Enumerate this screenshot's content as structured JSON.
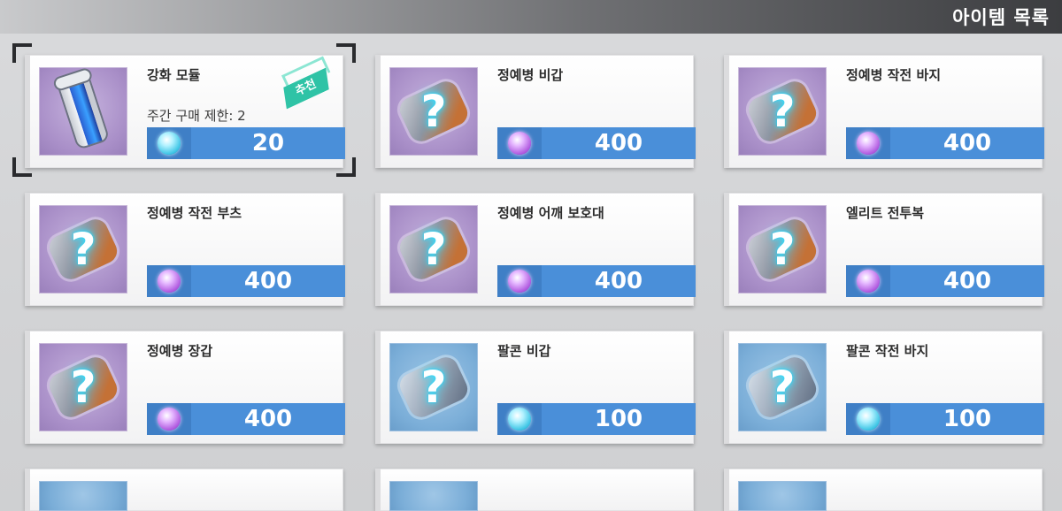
{
  "header": {
    "title": "아이템 목록"
  },
  "colors": {
    "price_bar": "#4a8fd9",
    "badge": "#2fc3a6",
    "selection": "#2a2b2e"
  },
  "items": [
    {
      "name": "강화 모듈",
      "limit": "주간 구매 제한: 2",
      "badge": "추천",
      "price": "20",
      "currency_icon": "cyan-gem-icon",
      "thumb_icon": "canister-icon",
      "bg": "purple",
      "selected": true
    },
    {
      "name": "정예병 비갑",
      "price": "400",
      "currency_icon": "purple-gem-icon",
      "thumb_icon": "unknown-gear-icon",
      "bg": "purple"
    },
    {
      "name": "정예병 작전 바지",
      "price": "400",
      "currency_icon": "purple-gem-icon",
      "thumb_icon": "unknown-gear-icon",
      "bg": "purple"
    },
    {
      "name": "정예병 작전 부츠",
      "price": "400",
      "currency_icon": "purple-gem-icon",
      "thumb_icon": "unknown-gear-icon",
      "bg": "purple"
    },
    {
      "name": "정예병 어깨 보호대",
      "price": "400",
      "currency_icon": "purple-gem-icon",
      "thumb_icon": "unknown-gear-icon",
      "bg": "purple"
    },
    {
      "name": "엘리트 전투복",
      "price": "400",
      "currency_icon": "purple-gem-icon",
      "thumb_icon": "unknown-gear-icon",
      "bg": "purple"
    },
    {
      "name": "정예병 장갑",
      "price": "400",
      "currency_icon": "purple-gem-icon",
      "thumb_icon": "unknown-gear-icon",
      "bg": "purple"
    },
    {
      "name": "팔콘 비갑",
      "price": "100",
      "currency_icon": "cyan-gem-icon",
      "thumb_icon": "unknown-gear-icon",
      "bg": "blue"
    },
    {
      "name": "팔콘 작전 바지",
      "price": "100",
      "currency_icon": "cyan-gem-icon",
      "thumb_icon": "unknown-gear-icon",
      "bg": "blue"
    }
  ],
  "unknown_mark": "?"
}
